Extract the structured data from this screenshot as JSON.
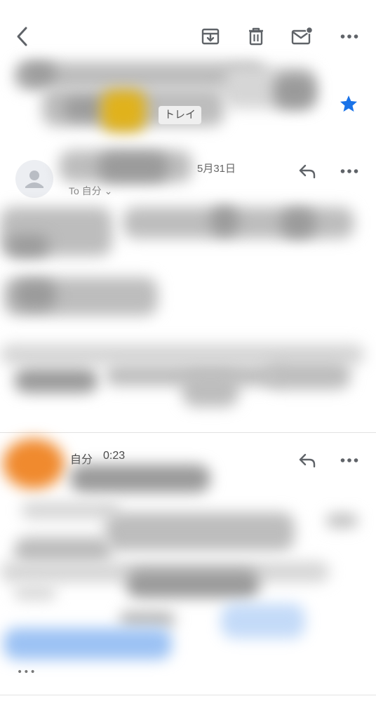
{
  "toolbar": {
    "icons": [
      "back-icon",
      "archive-icon",
      "trash-icon",
      "mark-unread-icon",
      "more-icon"
    ]
  },
  "thread": {
    "label_chip": "トレイ",
    "starred": true,
    "star_color": "#1a73e8"
  },
  "message1": {
    "date": "5月31日",
    "to_line": "To 自分 ⌄"
  },
  "message2": {
    "sender": "自分",
    "time": "0:23"
  },
  "footer": {
    "ellipsis": "•••"
  },
  "colors": {
    "accent": "#1a73e8",
    "icon": "#5f6368"
  }
}
